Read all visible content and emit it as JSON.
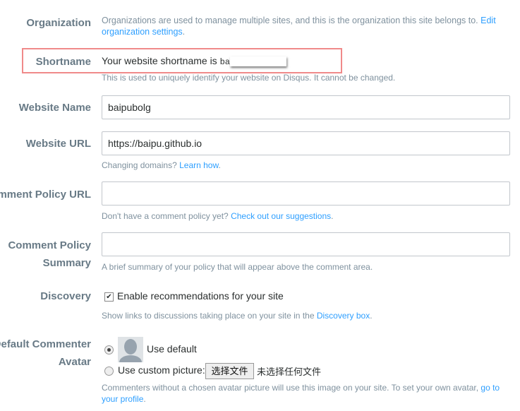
{
  "organization": {
    "label": "Organization",
    "text": "Organizations are used to manage multiple sites, and this is the organization this site belongs to.",
    "link": "Edit organization settings",
    "end": "."
  },
  "shortname": {
    "label": "Shortname",
    "text": "Your website shortname is",
    "value": "ba",
    "help": "This is used to uniquely identify your website on Disqus. It cannot be changed."
  },
  "website_name": {
    "label": "Website Name",
    "value": "baipubolg"
  },
  "website_url": {
    "label": "Website URL",
    "value": "https://baipu.github.io",
    "help": "Changing domains?",
    "link": "Learn how",
    "end": "."
  },
  "policy_url": {
    "label": "Comment Policy URL",
    "value": "",
    "help": "Don't have a comment policy yet?",
    "link": "Check out our suggestions",
    "end": "."
  },
  "policy_summary": {
    "label1": "Comment Policy",
    "label2": "Summary",
    "value": "",
    "help": "A brief summary of your policy that will appear above the comment area."
  },
  "discovery": {
    "label": "Discovery",
    "checkbox": "Enable recommendations for your site",
    "checked": true,
    "help": "Show links to discussions taking place on your site in the",
    "link": "Discovery box",
    "end": "."
  },
  "avatar": {
    "label1": "Default Commenter",
    "label2": "Avatar",
    "default_option": "Use default",
    "custom_option": "Use custom picture:",
    "file_button": "选择文件",
    "file_status": "未选择任何文件",
    "selected": "default",
    "help": "Commenters without a chosen avatar picture will use this image on your site. To set your own avatar,",
    "link": "go to your profile",
    "end": "."
  }
}
